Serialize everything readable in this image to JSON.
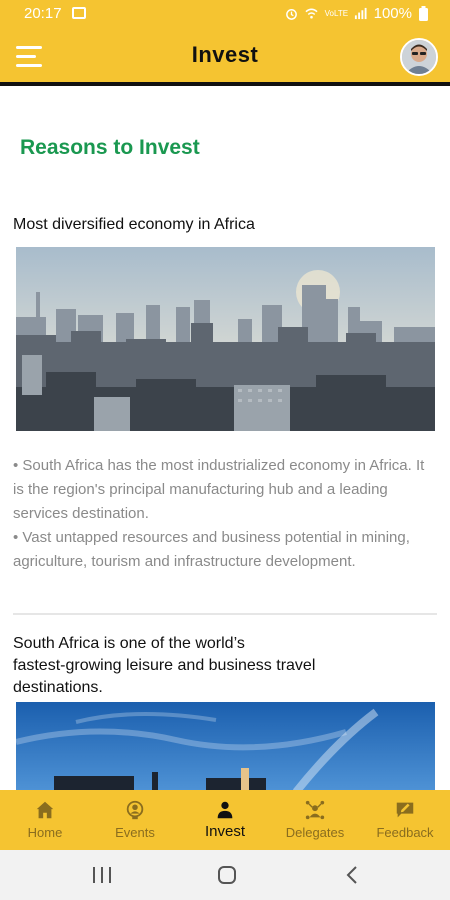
{
  "status": {
    "time": "20:17",
    "battery": "100%",
    "network": "VoLTE"
  },
  "appbar": {
    "title": "Invest"
  },
  "content": {
    "section_title": "Reasons to Invest",
    "item1": {
      "title": "Most diversified economy in Africa",
      "bullet1": "• South Africa has the most industrialized economy in Africa. It is the region's principal manufacturing hub and a leading services destination.",
      "bullet2": "• Vast untapped resources and business potential in mining, agriculture, tourism and infrastructure development."
    },
    "item2": {
      "title_line1": "South Africa is one of the world’s",
      "title_line2": "fastest-growing leisure and business travel",
      "title_line3": "destinations."
    }
  },
  "bottom_nav": [
    {
      "label": "Home",
      "icon": "home-icon"
    },
    {
      "label": "Events",
      "icon": "events-icon"
    },
    {
      "label": "Invest",
      "icon": "person-icon",
      "active": true
    },
    {
      "label": "Delegates",
      "icon": "delegates-icon"
    },
    {
      "label": "Feedback",
      "icon": "feedback-icon"
    }
  ],
  "colors": {
    "brand_yellow": "#f5c431",
    "title_green": "#1a9850",
    "body_grey": "#8a8a8a"
  }
}
